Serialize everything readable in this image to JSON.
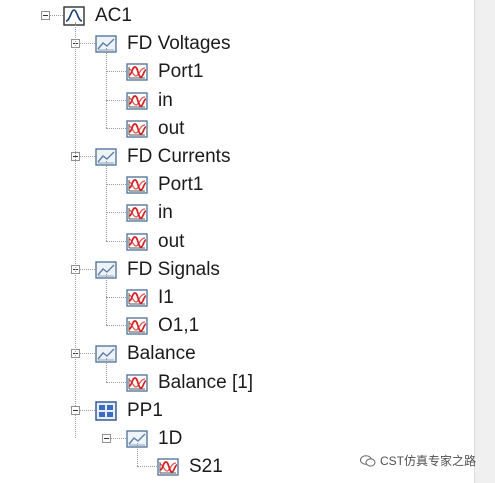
{
  "tree": {
    "root": {
      "label": "AC1",
      "icon": "ac-analysis-icon"
    },
    "groups": [
      {
        "label": "FD Voltages",
        "icon": "result-folder-icon",
        "children": [
          {
            "label": "Port1"
          },
          {
            "label": "in"
          },
          {
            "label": "out"
          }
        ]
      },
      {
        "label": "FD Currents",
        "icon": "result-folder-icon",
        "children": [
          {
            "label": "Port1"
          },
          {
            "label": "in"
          },
          {
            "label": "out"
          }
        ]
      },
      {
        "label": "FD Signals",
        "icon": "result-folder-icon",
        "children": [
          {
            "label": "I1"
          },
          {
            "label": "O1,1"
          }
        ]
      },
      {
        "label": "Balance",
        "icon": "result-folder-icon",
        "children": [
          {
            "label": "Balance [1]"
          }
        ]
      }
    ],
    "pp": {
      "label": "PP1",
      "icon": "postprocessing-icon",
      "sub": {
        "label": "1D",
        "icon": "result-folder-icon",
        "children": [
          {
            "label": "S21"
          }
        ]
      }
    },
    "child_icon": "frequency-plot-icon"
  },
  "watermark": {
    "text": "CST仿真专家之路",
    "icon": "wechat-icon"
  },
  "colors": {
    "plot_red": "#d42020",
    "plot_frame": "#4a6e93",
    "folder_blue": "#5a7fa8"
  }
}
